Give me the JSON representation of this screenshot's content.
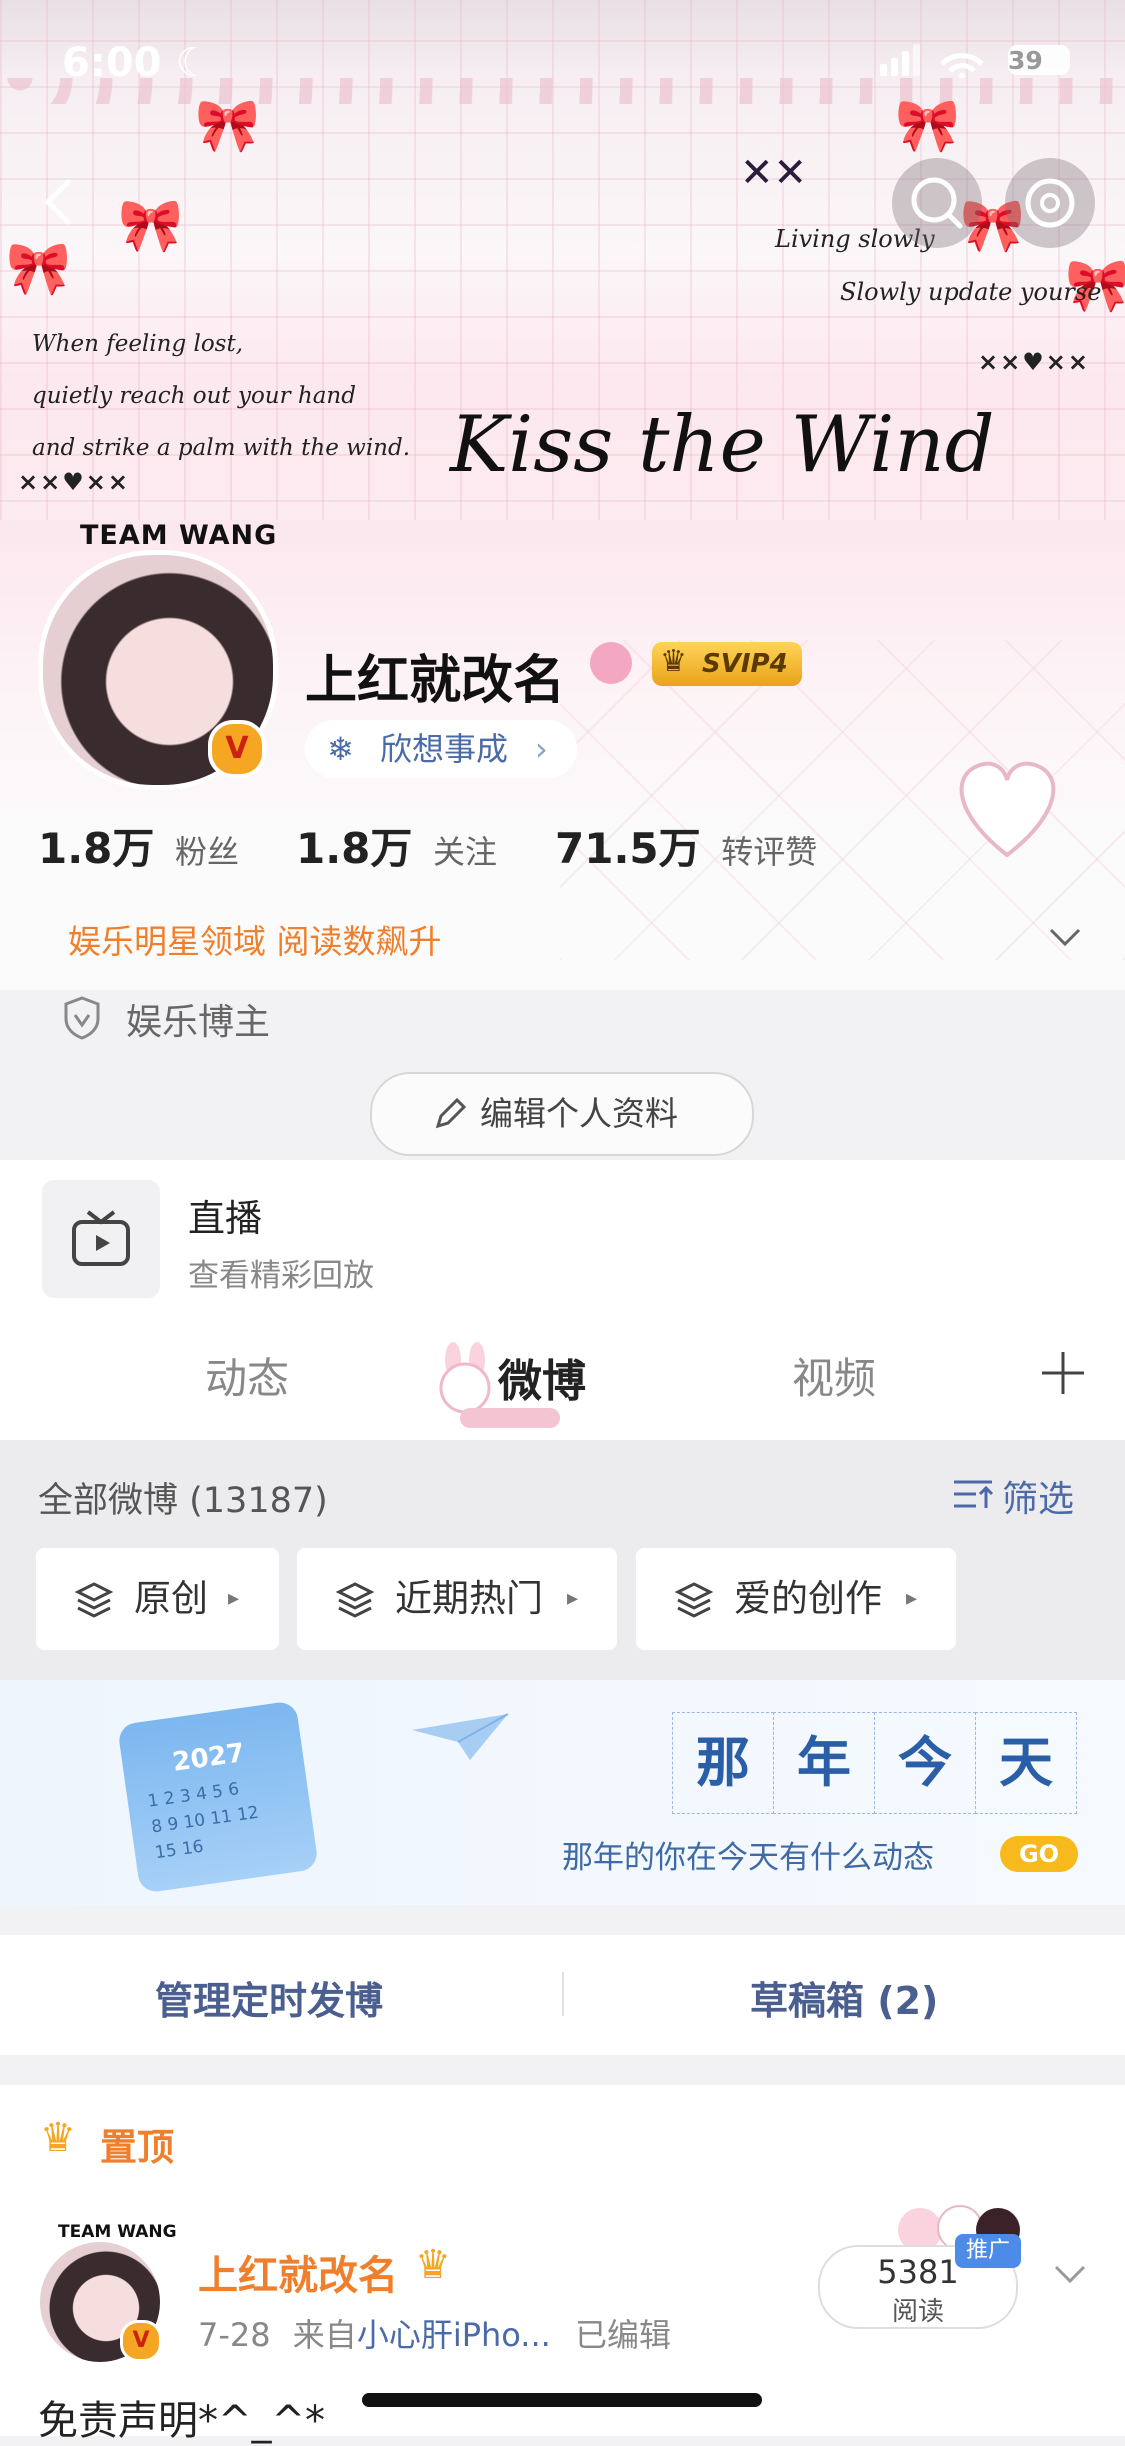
{
  "status_bar": {
    "time": "6:00",
    "battery": "39"
  },
  "banner": {
    "left_poem": [
      "When feeling lost,",
      "quietly reach out your hand",
      "and strike a palm with the wind."
    ],
    "right_poem": [
      "Living slowly",
      "Slowly update yourse"
    ],
    "marks": "×××××",
    "marks_left": "××♥××",
    "marks_right": "××♥××",
    "title": "Kiss the Wind"
  },
  "profile": {
    "avatar_caption": "TEAM WANG",
    "name": "上红就改名",
    "svip": "SVIP4",
    "motto": "欣想事成",
    "stats": [
      {
        "value": "1.8万",
        "label": "粉丝"
      },
      {
        "value": "1.8万",
        "label": "关注"
      },
      {
        "value": "71.5万",
        "label": "转评赞"
      }
    ],
    "domain_text": "娱乐明星领域 阅读数飙升",
    "tag": "娱乐博主",
    "edit_button": "编辑个人资料"
  },
  "live": {
    "title": "直播",
    "subtitle": "查看精彩回放"
  },
  "tabs": [
    "动态",
    "微博",
    "视频"
  ],
  "feed_header": {
    "count_label": "全部微博 (13187)",
    "filter": "筛选"
  },
  "chips": [
    "原创",
    "近期热门",
    "爱的创作"
  ],
  "memory_banner": {
    "calendar_year": "2027",
    "calendar_days": "1 2 3 4 5 6",
    "calendar_days2": "8 9 10 11 12",
    "calendar_days3": "15 16",
    "title_chars": [
      "那",
      "年",
      "今",
      "天"
    ],
    "subtitle": "那年的你在今天有什么动态",
    "go": "GO"
  },
  "actions": {
    "scheduled": "管理定时发博",
    "drafts": "草稿箱 (2)"
  },
  "pinned": {
    "label": "置顶",
    "author": "上红就改名",
    "avatar_caption": "TEAM WANG",
    "meta_date": "7-28",
    "meta_from": "来自",
    "meta_source": "小心肝iPho...",
    "meta_edited": "已编辑",
    "reads": "5381",
    "reads_label": "阅读",
    "promo": "推广",
    "content_preview": "免责声明*^_^*"
  },
  "colors": {
    "accent_orange": "#f07f2b",
    "link_blue": "#4a6aa8",
    "tab_active": "#222222"
  }
}
